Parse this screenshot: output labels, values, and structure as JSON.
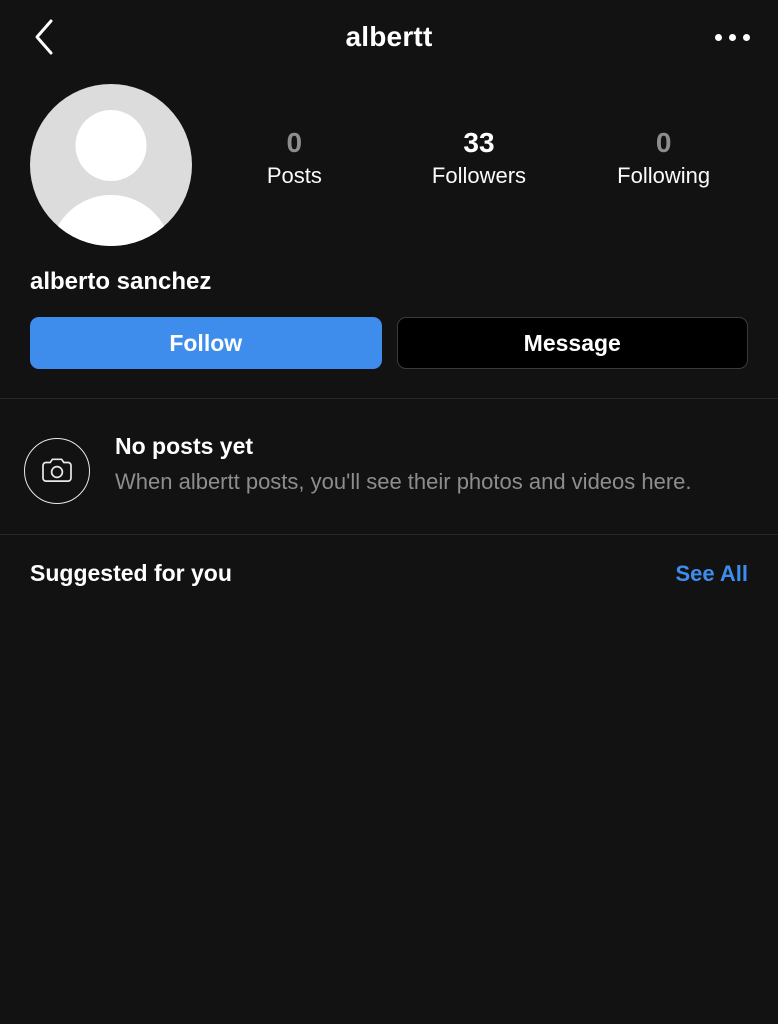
{
  "topbar": {
    "back_icon": "chevron-left-icon",
    "title": "albertt",
    "more_icon": "more-options-icon"
  },
  "profile": {
    "avatar_icon": "default-avatar-icon",
    "username": "albertt",
    "full_name": "alberto sanchez",
    "stats": [
      {
        "key": "posts",
        "value": "0",
        "label": "Posts",
        "dim": true
      },
      {
        "key": "followers",
        "value": "33",
        "label": "Followers",
        "dim": false
      },
      {
        "key": "following",
        "value": "0",
        "label": "Following",
        "dim": true
      }
    ],
    "actions": {
      "follow_label": "Follow",
      "message_label": "Message"
    }
  },
  "empty_state": {
    "icon": "camera-icon",
    "title": "No posts yet",
    "description": "When albertt posts, you'll see their photos and videos here."
  },
  "suggested": {
    "title": "Suggested for you",
    "see_all_label": "See All"
  },
  "colors": {
    "background": "#121212",
    "accent_blue": "#3e8ded",
    "text_primary": "#ffffff",
    "text_secondary": "#8d8d8d",
    "divider": "#272727",
    "avatar_bg": "#dcdcdc",
    "message_btn_bg": "#000000",
    "message_btn_border": "#3b3b3b"
  }
}
